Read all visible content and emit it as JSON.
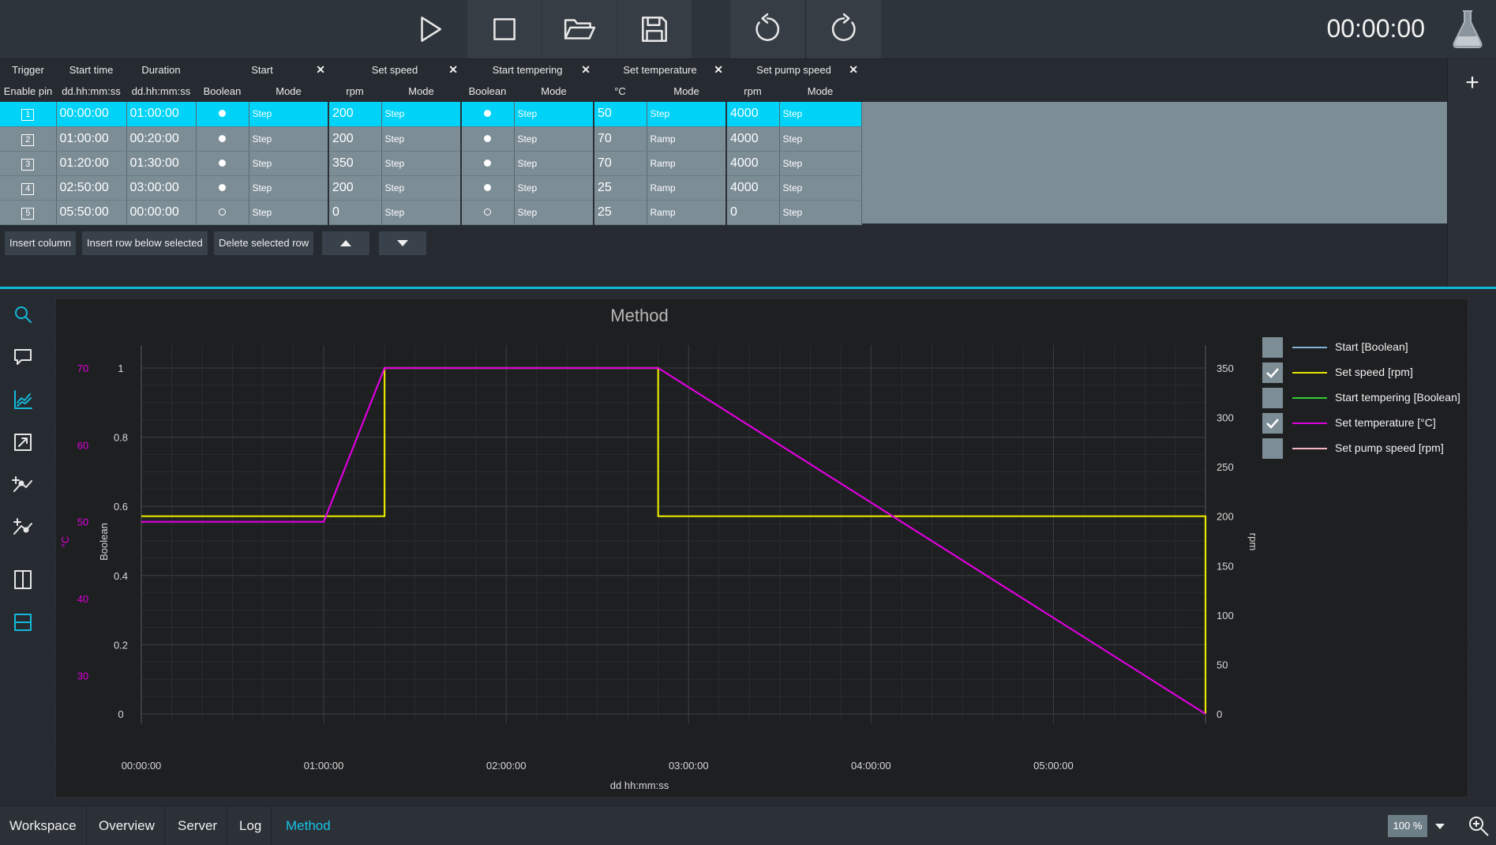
{
  "toolbar": {
    "timer": "00:00:00",
    "buttons": [
      "play-icon",
      "stop-icon",
      "open-folder-icon",
      "save-icon",
      "undo-icon",
      "redo-icon"
    ]
  },
  "table": {
    "group_headers": {
      "trigger": "Trigger",
      "start_time": "Start time",
      "duration": "Duration",
      "start": "Start",
      "set_speed": "Set speed",
      "start_tempering": "Start tempering",
      "set_temperature": "Set temperature",
      "set_pump_speed": "Set pump speed"
    },
    "close_glyph": "✕",
    "sub_headers": {
      "enable_pin": "Enable pin",
      "start_time_fmt": "dd.hh:mm:ss",
      "duration_fmt": "dd.hh:mm:ss",
      "start_type": "Boolean",
      "start_mode": "Mode",
      "speed_unit": "rpm",
      "speed_mode": "Mode",
      "tempering_type": "Boolean",
      "tempering_mode": "Mode",
      "temp_unit": "°C",
      "temp_mode": "Mode",
      "pump_unit": "rpm",
      "pump_mode": "Mode"
    },
    "rows": [
      {
        "pin": "1",
        "start_time": "00:00:00",
        "duration": "01:00:00",
        "start_on": true,
        "start_mode": "Step",
        "speed": "200",
        "speed_mode": "Step",
        "temper_on": true,
        "temper_mode": "Step",
        "temp": "50",
        "temp_mode": "Step",
        "pump": "4000",
        "pump_mode": "Step"
      },
      {
        "pin": "2",
        "start_time": "01:00:00",
        "duration": "00:20:00",
        "start_on": true,
        "start_mode": "Step",
        "speed": "200",
        "speed_mode": "Step",
        "temper_on": true,
        "temper_mode": "Step",
        "temp": "70",
        "temp_mode": "Ramp",
        "pump": "4000",
        "pump_mode": "Step"
      },
      {
        "pin": "3",
        "start_time": "01:20:00",
        "duration": "01:30:00",
        "start_on": true,
        "start_mode": "Step",
        "speed": "350",
        "speed_mode": "Step",
        "temper_on": true,
        "temper_mode": "Step",
        "temp": "70",
        "temp_mode": "Ramp",
        "pump": "4000",
        "pump_mode": "Step"
      },
      {
        "pin": "4",
        "start_time": "02:50:00",
        "duration": "03:00:00",
        "start_on": true,
        "start_mode": "Step",
        "speed": "200",
        "speed_mode": "Step",
        "temper_on": true,
        "temper_mode": "Step",
        "temp": "25",
        "temp_mode": "Ramp",
        "pump": "4000",
        "pump_mode": "Step"
      },
      {
        "pin": "5",
        "start_time": "05:50:00",
        "duration": "00:00:00",
        "start_on": false,
        "start_mode": "Step",
        "speed": "0",
        "speed_mode": "Step",
        "temper_on": false,
        "temper_mode": "Step",
        "temp": "25",
        "temp_mode": "Ramp",
        "pump": "0",
        "pump_mode": "Step"
      }
    ],
    "selected_row": 0,
    "actions": {
      "insert_column": "Insert column",
      "insert_row": "Insert row below selected",
      "delete_row": "Delete selected row"
    },
    "add_column_glyph": "+"
  },
  "sidenav": [
    "search-icon",
    "comment-icon",
    "line-chart-icon",
    "fit-view-icon",
    "add-point-icon",
    "move-point-icon",
    "split-vertical-icon",
    "split-horizontal-icon"
  ],
  "chart_data": {
    "type": "line",
    "title": "Method",
    "xlabel": "dd hh:mm:ss",
    "x_ticks": [
      "00:00:00",
      "01:00:00",
      "02:00:00",
      "03:00:00",
      "04:00:00",
      "05:00:00"
    ],
    "x_unit": "hours",
    "xlim": [
      0,
      5.8333
    ],
    "axes": {
      "temp": {
        "label": "°C",
        "ticks": [
          "30",
          "40",
          "50",
          "60",
          "70"
        ],
        "range": [
          25,
          70
        ]
      },
      "boolean": {
        "label": "Boolean",
        "ticks": [
          "0",
          "0.2",
          "0.4",
          "0.6",
          "0.8",
          "1"
        ],
        "range": [
          0,
          1
        ]
      },
      "rpm": {
        "label": "rpm",
        "ticks": [
          "0",
          "50",
          "100",
          "150",
          "200",
          "250",
          "300",
          "350"
        ],
        "range": [
          0,
          350
        ]
      }
    },
    "series": [
      {
        "name": "Start [Boolean]",
        "color": "#7fb2d6",
        "axis": "boolean",
        "visible": false,
        "x": [],
        "y": []
      },
      {
        "name": "Set speed [rpm]",
        "color": "#e6e600",
        "axis": "rpm",
        "visible": true,
        "x": [
          0,
          1.3333,
          1.3333,
          2.8333,
          2.8333,
          5.8333,
          5.8333
        ],
        "y": [
          200,
          200,
          350,
          350,
          200,
          200,
          0
        ]
      },
      {
        "name": "Start tempering [Boolean]",
        "color": "#33cc33",
        "axis": "boolean",
        "visible": false,
        "x": [],
        "y": []
      },
      {
        "name": "Set temperature [°C]",
        "color": "#dd00dd",
        "axis": "temp",
        "visible": true,
        "x": [
          0,
          1.0,
          1.3333,
          2.8333,
          5.8333
        ],
        "y": [
          50,
          50,
          70,
          70,
          25
        ]
      },
      {
        "name": "Set pump speed [rpm]",
        "color": "#f4b6c2",
        "axis": "rpm",
        "visible": false,
        "x": [],
        "y": []
      }
    ],
    "grid": true,
    "legend": "right"
  },
  "bottom_tabs": [
    "Workspace",
    "Overview",
    "Server",
    "Log",
    "Method"
  ],
  "active_tab": "Method",
  "zoom": "100 %",
  "colors": {
    "accent": "#13b9da",
    "selected_row": "#00d3f7",
    "cell": "#7c8d96"
  }
}
